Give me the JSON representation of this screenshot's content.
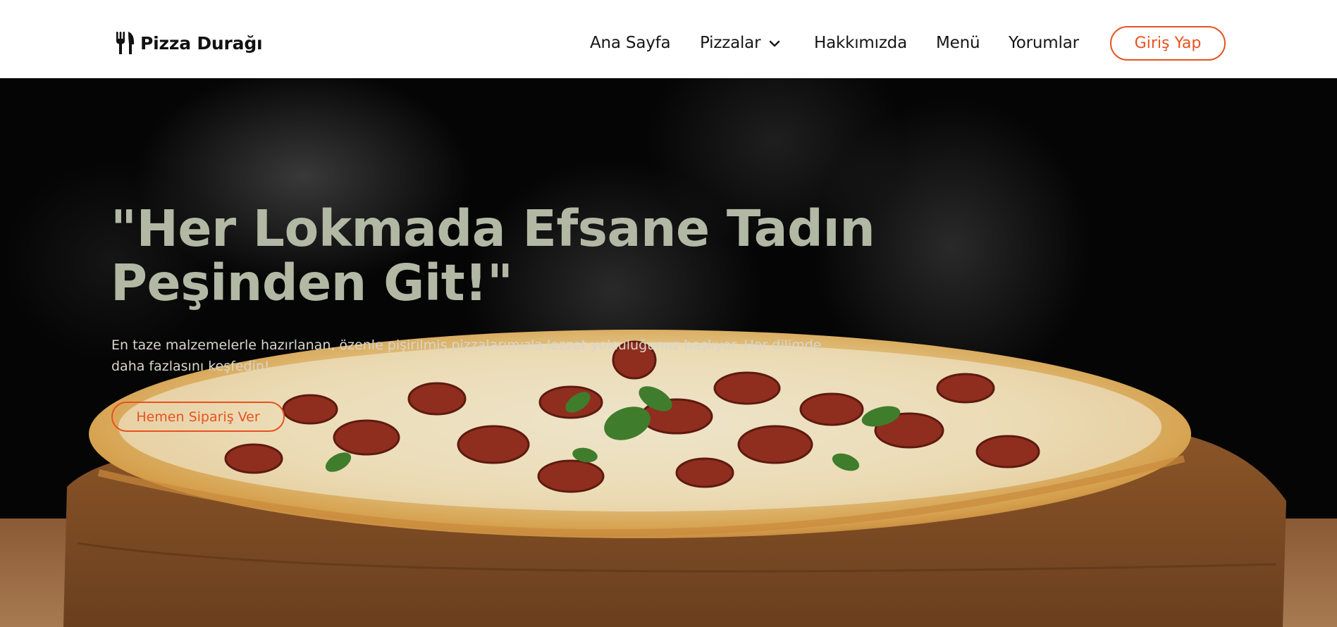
{
  "header": {
    "brand": {
      "name": "Pizza Durağı",
      "icon": "fork-knife-icon"
    },
    "nav": [
      {
        "label": "Ana Sayfa"
      },
      {
        "label": "Pizzalar",
        "icon": "chevron-down-icon"
      },
      {
        "label": "Hakkımızda"
      },
      {
        "label": "Menü"
      },
      {
        "label": "Yorumlar"
      }
    ],
    "login_label": "Giriş Yap"
  },
  "hero": {
    "title": "\"Her Lokmada Efsane Tadın Peşinden Git!\"",
    "description": "En taze malzemelerle hazırlanan, özenle pişirilmiş pizzalarımızla lezzet yolculuğunuz başlıyor. Her dilimde daha fazlasını keşfedin!",
    "cta_label": "Hemen Sipariş Ver",
    "background_image": "pizza-on-wooden-board"
  },
  "colors": {
    "accent": "#e8521f",
    "hero_title": "#b3b8a5",
    "header_bg": "#ffffff",
    "hero_bg": "#050505"
  }
}
